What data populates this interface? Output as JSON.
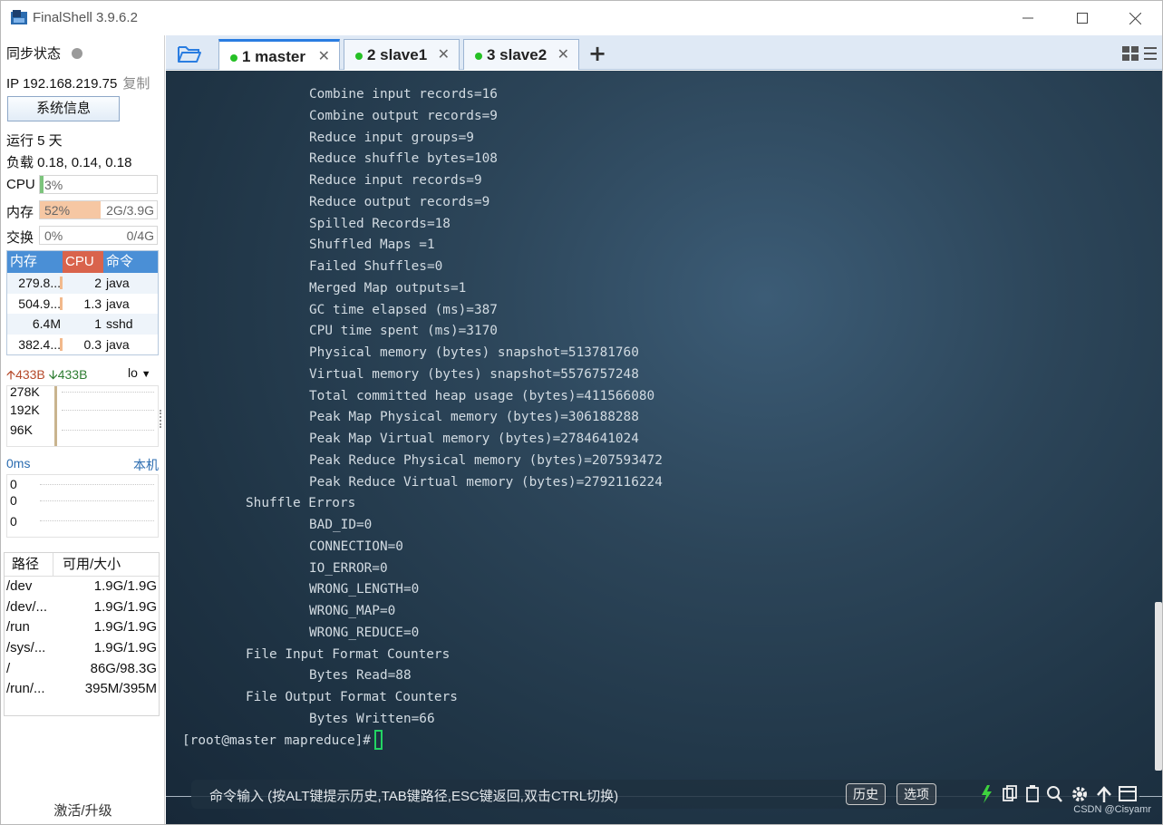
{
  "titlebar": {
    "title": "FinalShell 3.9.6.2"
  },
  "sidebar": {
    "sync_label": "同步状态",
    "ip_label": "IP 192.168.219.75",
    "copy_label": "复制",
    "sysinfo_button": "系统信息",
    "uptime": "运行 5 天",
    "load": "负载 0.18, 0.14, 0.18",
    "cpu": {
      "label": "CPU",
      "percent_text": "3%",
      "fraction": 0.03
    },
    "mem": {
      "label": "内存",
      "percent_text": "52%",
      "amount": "2G/3.9G",
      "fraction": 0.52
    },
    "swap": {
      "label": "交换",
      "percent_text": "0%",
      "amount": "0/4G",
      "fraction": 0.0
    },
    "process_table": {
      "headers": [
        "内存",
        "CPU",
        "命令"
      ],
      "rows": [
        {
          "mem": "279.8...",
          "cpu": "2",
          "cmd": "java"
        },
        {
          "mem": "504.9...",
          "cpu": "1.3",
          "cmd": "java"
        },
        {
          "mem": "6.4M",
          "cpu": "1",
          "cmd": "sshd"
        },
        {
          "mem": "382.4...",
          "cpu": "0.3",
          "cmd": "java"
        }
      ]
    },
    "network": {
      "up": "433B",
      "down": "433B",
      "interface": "lo",
      "scale": [
        "278K",
        "192K",
        "96K"
      ]
    },
    "ping": {
      "latency": "0ms",
      "host": "本机",
      "values": [
        "0",
        "0",
        "0"
      ]
    },
    "disk_table": {
      "headers": [
        "路径",
        "可用/大小"
      ],
      "rows": [
        {
          "path": "/dev",
          "size": "1.9G/1.9G"
        },
        {
          "path": "/dev/...",
          "size": "1.9G/1.9G"
        },
        {
          "path": "/run",
          "size": "1.9G/1.9G"
        },
        {
          "path": "/sys/...",
          "size": "1.9G/1.9G"
        },
        {
          "path": "/",
          "size": "86G/98.3G"
        },
        {
          "path": "/run/...",
          "size": "395M/395M"
        }
      ]
    },
    "activate_label": "激活/升级"
  },
  "tabs": [
    {
      "label": "1 master",
      "active": true
    },
    {
      "label": "2 slave1",
      "active": false
    },
    {
      "label": "3 slave2",
      "active": false
    }
  ],
  "terminal": {
    "lines": [
      {
        "indent": 2,
        "text": "Combine input records=16"
      },
      {
        "indent": 2,
        "text": "Combine output records=9"
      },
      {
        "indent": 2,
        "text": "Reduce input groups=9"
      },
      {
        "indent": 2,
        "text": "Reduce shuffle bytes=108"
      },
      {
        "indent": 2,
        "text": "Reduce input records=9"
      },
      {
        "indent": 2,
        "text": "Reduce output records=9"
      },
      {
        "indent": 2,
        "text": "Spilled Records=18"
      },
      {
        "indent": 2,
        "text": "Shuffled Maps =1"
      },
      {
        "indent": 2,
        "text": "Failed Shuffles=0"
      },
      {
        "indent": 2,
        "text": "Merged Map outputs=1"
      },
      {
        "indent": 2,
        "text": "GC time elapsed (ms)=387"
      },
      {
        "indent": 2,
        "text": "CPU time spent (ms)=3170"
      },
      {
        "indent": 2,
        "text": "Physical memory (bytes) snapshot=513781760"
      },
      {
        "indent": 2,
        "text": "Virtual memory (bytes) snapshot=5576757248"
      },
      {
        "indent": 2,
        "text": "Total committed heap usage (bytes)=411566080"
      },
      {
        "indent": 2,
        "text": "Peak Map Physical memory (bytes)=306188288"
      },
      {
        "indent": 2,
        "text": "Peak Map Virtual memory (bytes)=2784641024"
      },
      {
        "indent": 2,
        "text": "Peak Reduce Physical memory (bytes)=207593472"
      },
      {
        "indent": 2,
        "text": "Peak Reduce Virtual memory (bytes)=2792116224"
      },
      {
        "indent": 1,
        "text": "Shuffle Errors"
      },
      {
        "indent": 2,
        "text": "BAD_ID=0"
      },
      {
        "indent": 2,
        "text": "CONNECTION=0"
      },
      {
        "indent": 2,
        "text": "IO_ERROR=0"
      },
      {
        "indent": 2,
        "text": "WRONG_LENGTH=0"
      },
      {
        "indent": 2,
        "text": "WRONG_MAP=0"
      },
      {
        "indent": 2,
        "text": "WRONG_REDUCE=0"
      },
      {
        "indent": 1,
        "text": "File Input Format Counters"
      },
      {
        "indent": 2,
        "text": "Bytes Read=88"
      },
      {
        "indent": 1,
        "text": "File Output Format Counters"
      },
      {
        "indent": 2,
        "text": "Bytes Written=66"
      }
    ],
    "prompt": "[root@master mapreduce]#"
  },
  "command_bar": {
    "hint": "命令输入 (按ALT键提示历史,TAB键路径,ESC键返回,双击CTRL切换)",
    "history_button": "历史",
    "options_button": "选项"
  },
  "watermark": "CSDN @Cisyamr",
  "colors": {
    "accent": "#2a7de1",
    "online_dot": "#25c025",
    "mem_header": "#4a8fd6",
    "cpu_header": "#d9634c",
    "mem_fill": "#f6c7a3",
    "cpu_fill": "#7cc47c",
    "cursor": "#23d463"
  }
}
